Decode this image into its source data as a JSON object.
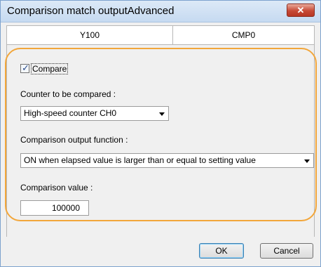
{
  "window": {
    "title": "Comparison match outputAdvanced",
    "close_label": "✕"
  },
  "columns": {
    "left": "Y100",
    "right": "CMP0"
  },
  "compare": {
    "label": "Compare",
    "checked": true
  },
  "counter": {
    "label": "Counter to be compared :",
    "value": "High-speed counter CH0"
  },
  "output_function": {
    "label": "Comparison output function :",
    "value": "ON when elapsed value is larger than or equal to setting value"
  },
  "comparison_value": {
    "label": "Comparison value :",
    "value": "100000"
  },
  "buttons": {
    "ok": "OK",
    "cancel": "Cancel"
  },
  "colors": {
    "highlight": "#f2a63a",
    "titlebar": "#c6daf1",
    "close": "#c74a36"
  }
}
